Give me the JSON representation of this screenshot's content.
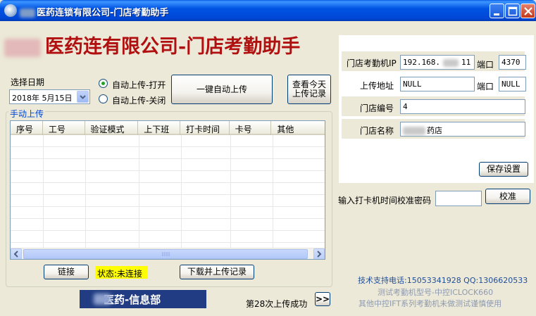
{
  "window": {
    "title": "医药连锁有限公司-门店考勤助手"
  },
  "header": {
    "title": "医药连有限公司-门店考勤助手"
  },
  "date_section": {
    "label": "选择日期",
    "value": "2018年 5月15日"
  },
  "auto_upload": {
    "option_on": "自动上传-打开",
    "option_off": "自动上传-关闭",
    "selected": "on",
    "button": "一键自动上传",
    "view_today_button": "查看今天上传记录"
  },
  "manual_upload": {
    "caption": "手动上传",
    "columns": [
      "序号",
      "工号",
      "验证模式",
      "上下班",
      "打卡时间",
      "卡号",
      "其他"
    ],
    "rows": []
  },
  "actions": {
    "link_button": "链接",
    "status": "状态:未连接",
    "download_button": "下载并上传记录"
  },
  "brand": {
    "label": "医药-信息部"
  },
  "upload_status": {
    "text": "第28次上传成功",
    "next_button": ">>"
  },
  "settings": {
    "ip_label": "门店考勤机IP",
    "ip_value": "192.168.",
    "ip_suffix": "11",
    "port_label": "端口",
    "port_value": "4370",
    "url_label": "上传地址",
    "url_value": "NULL",
    "url_port_label": "端口",
    "url_port_value": "NULL",
    "store_no_label": "门店编号",
    "store_no_value": "4",
    "store_name_label": "门店名称",
    "store_name_value": "药店",
    "save_button": "保存设置"
  },
  "calibration": {
    "label": "输入打卡机时间校准密码",
    "value": "",
    "button": "校准"
  },
  "footer": {
    "support": "技术支持电话:15053341928 QQ:1306620533",
    "model": "测试考勤机型号-中控ICLOCK660",
    "note": "其他中控IFT系列考勤机未做测试谨慎使用"
  },
  "colors": {
    "titlebar": "#0054E3",
    "header_title": "#B01010",
    "status_badge": "#FFFF00",
    "brand_strip": "#213C82",
    "footer_text": "#1F4E9A"
  }
}
